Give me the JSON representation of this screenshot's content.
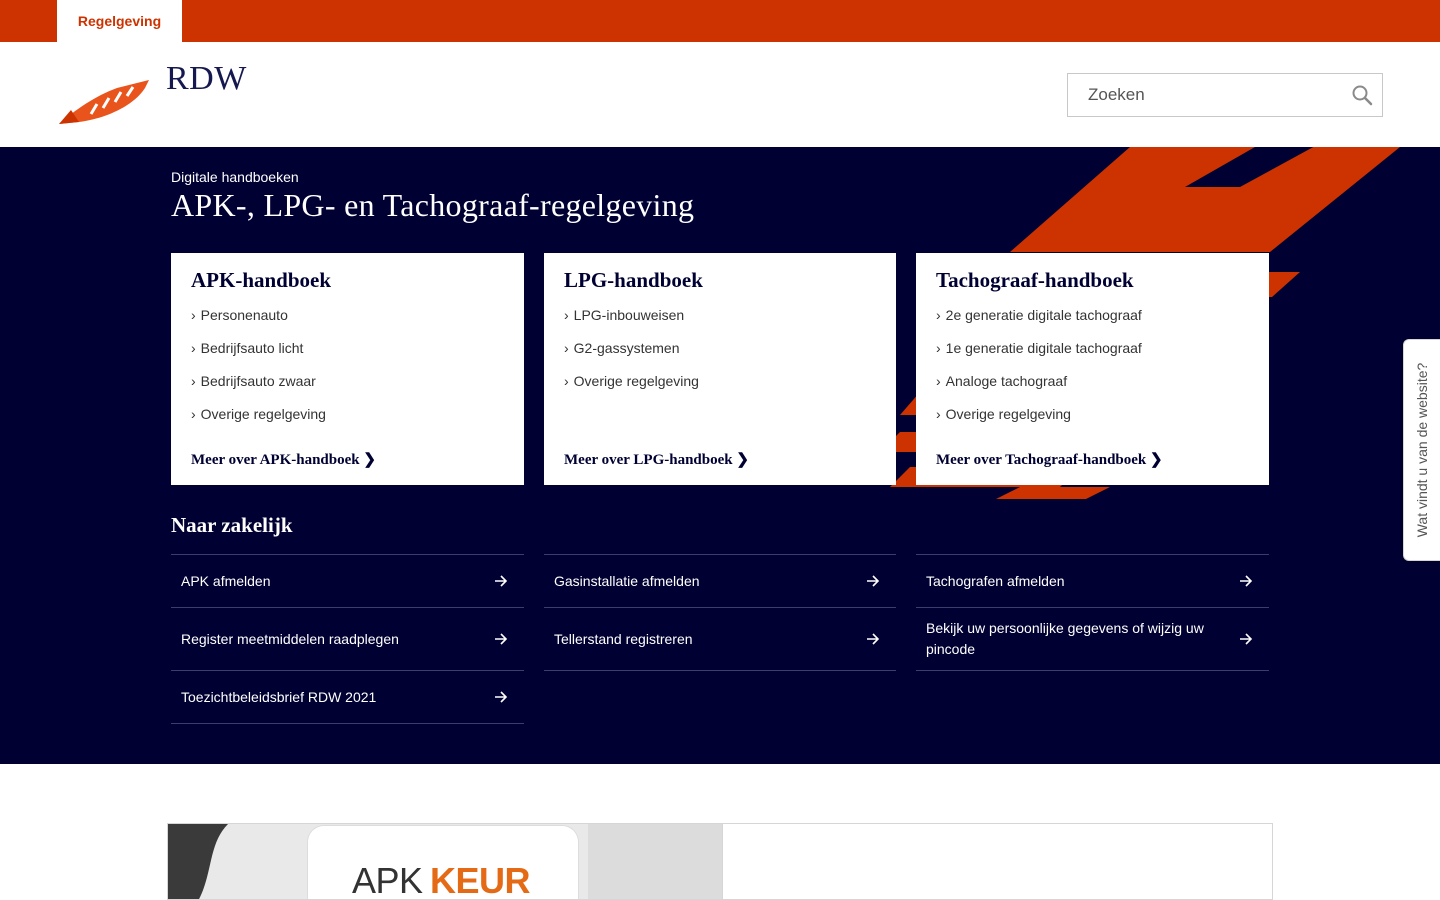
{
  "topbar": {
    "tab_label": "Regelgeving"
  },
  "header": {
    "logo_text": "RDW",
    "search": {
      "placeholder": "Zoeken",
      "value": ""
    }
  },
  "hero": {
    "kicker": "Digitale handboeken",
    "title": "APK-, LPG- en Tachograaf-regelgeving",
    "cards": [
      {
        "title": "APK-handboek",
        "items": [
          "Personenauto",
          "Bedrijfsauto licht",
          "Bedrijfsauto zwaar",
          "Overige regelgeving"
        ],
        "more": "Meer over APK-handboek"
      },
      {
        "title": "LPG-handboek",
        "items": [
          "LPG-inbouweisen",
          "G2-gassystemen",
          "Overige regelgeving"
        ],
        "more": "Meer over LPG-handboek"
      },
      {
        "title": "Tachograaf-handboek",
        "items": [
          "2e generatie digitale tachograaf",
          "1e generatie digitale tachograaf",
          "Analoge tachograaf",
          "Overige regelgeving"
        ],
        "more": "Meer over Tachograaf-handboek"
      }
    ],
    "section_title": "Naar zakelijk",
    "links": [
      [
        "APK afmelden",
        "Register meetmiddelen raadplegen",
        "Toezichtbeleidsbrief RDW 2021"
      ],
      [
        "Gasinstallatie afmelden",
        "Tellerstand registreren"
      ],
      [
        "Tachografen afmelden",
        "Bekijk uw persoonlijke gegevens of wijzig uw pincode"
      ]
    ]
  },
  "promo": {
    "sign_left": "APK",
    "sign_right": "KEUR"
  },
  "feedback": {
    "label": "Wat vindt u van de website?"
  },
  "colors": {
    "brand_orange": "#cc3300",
    "navy": "#000033",
    "sign_orange": "#e46a16"
  },
  "icons": [
    "rdw-logo-icon",
    "search-icon",
    "chevron-right-icon",
    "arrow-right-icon"
  ]
}
